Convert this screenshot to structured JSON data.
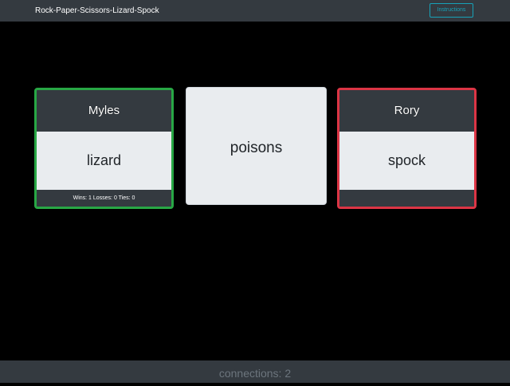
{
  "navbar": {
    "brand": "Rock-Paper-Scissors-Lizard-Spock",
    "instructions_label": "Instructions"
  },
  "player1": {
    "name": "Myles",
    "choice": "lizard",
    "stats": "Wins: 1 Losses: 0 Ties: 0",
    "status_color": "#28a745"
  },
  "result": {
    "verb": "poisons"
  },
  "player2": {
    "name": "Rory",
    "choice": "spock",
    "stats": "",
    "status_color": "#dc3545"
  },
  "footer": {
    "connections": "connections: 2"
  }
}
